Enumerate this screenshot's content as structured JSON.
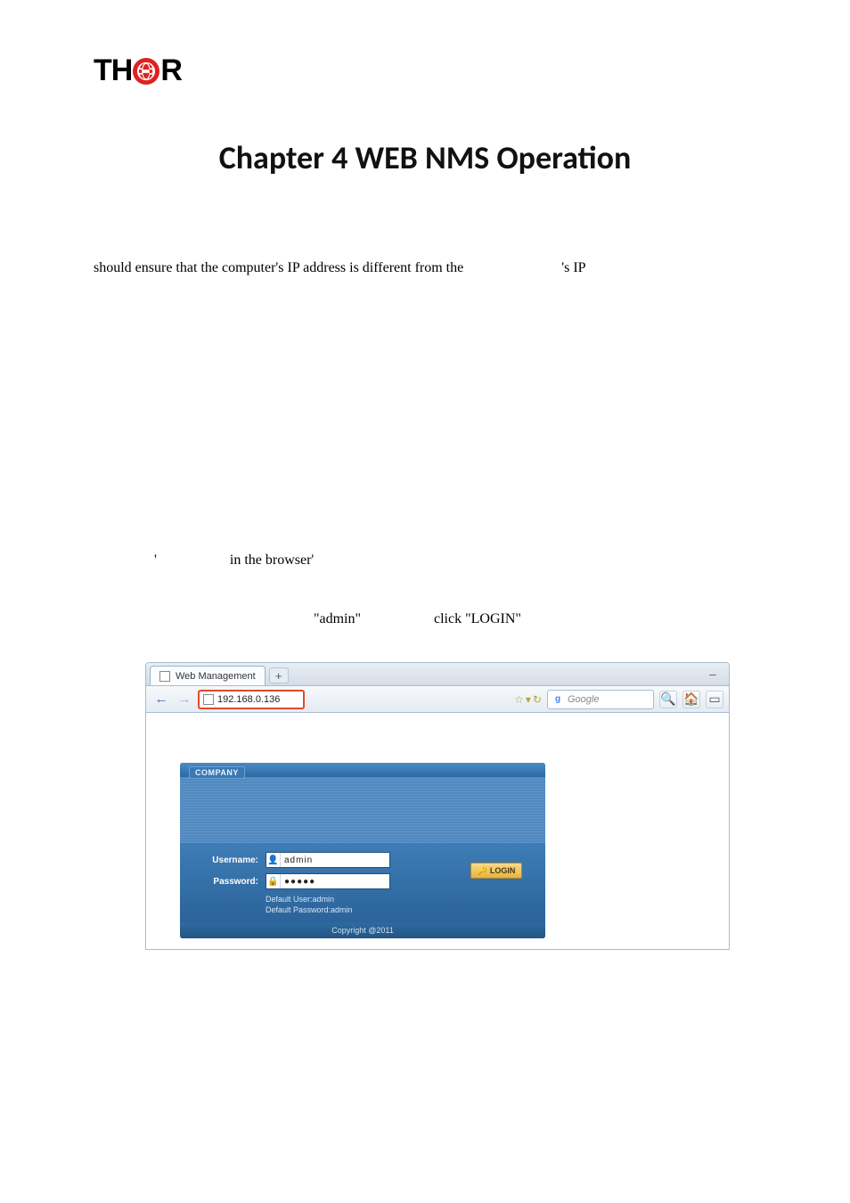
{
  "logo": {
    "t": "TH",
    "r": "R"
  },
  "title": "Chapter 4 WEB NMS Operation",
  "para1": {
    "a": "should ensure that the computer's IP address is different from the",
    "b": "'s IP"
  },
  "para2": {
    "a": "'",
    "b": "in the browser'"
  },
  "para3": {
    "a": "\"admin\"",
    "b": "click \"LOGIN\""
  },
  "browser": {
    "tab_title": "Web Management",
    "newtab": "+",
    "minimize": "–",
    "url": "192.168.0.136",
    "star": "☆",
    "dropdown": "▾",
    "reload": "↻",
    "search_placeholder": "Google",
    "search_icon": "🔍",
    "home_icon": "🏠",
    "menu_icon": "▭",
    "back": "←",
    "forward": "→"
  },
  "login": {
    "brand": "COMPANY",
    "username_label": "Username:",
    "username_value": "admin",
    "password_label": "Password:",
    "password_value": "●●●●●",
    "login_btn": "LOGIN",
    "hint1": "Default User:admin",
    "hint2": "Default Password:admin",
    "copyright": "Copyright @2011"
  }
}
